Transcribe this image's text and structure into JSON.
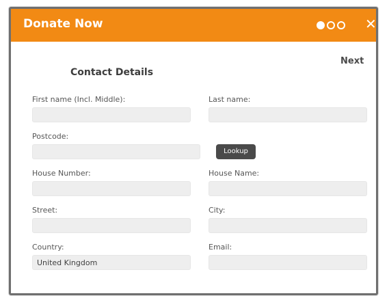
{
  "header": {
    "title": "Donate Now",
    "close_label": "✕",
    "steps": [
      true,
      false,
      false
    ],
    "color": "#f28a14"
  },
  "nav": {
    "next_label": "Next"
  },
  "form": {
    "section_title": "Contact Details",
    "first_name": {
      "label": "First name (Incl. Middle):",
      "value": ""
    },
    "last_name": {
      "label": "Last name:",
      "value": ""
    },
    "postcode": {
      "label": "Postcode:",
      "value": ""
    },
    "lookup_label": "Lookup",
    "house_number": {
      "label": "House Number:",
      "value": ""
    },
    "house_name": {
      "label": "House Name:",
      "value": ""
    },
    "street": {
      "label": "Street:",
      "value": ""
    },
    "city": {
      "label": "City:",
      "value": ""
    },
    "country": {
      "label": "Country:",
      "value": "United Kingdom"
    },
    "email": {
      "label": "Email:",
      "value": ""
    }
  }
}
